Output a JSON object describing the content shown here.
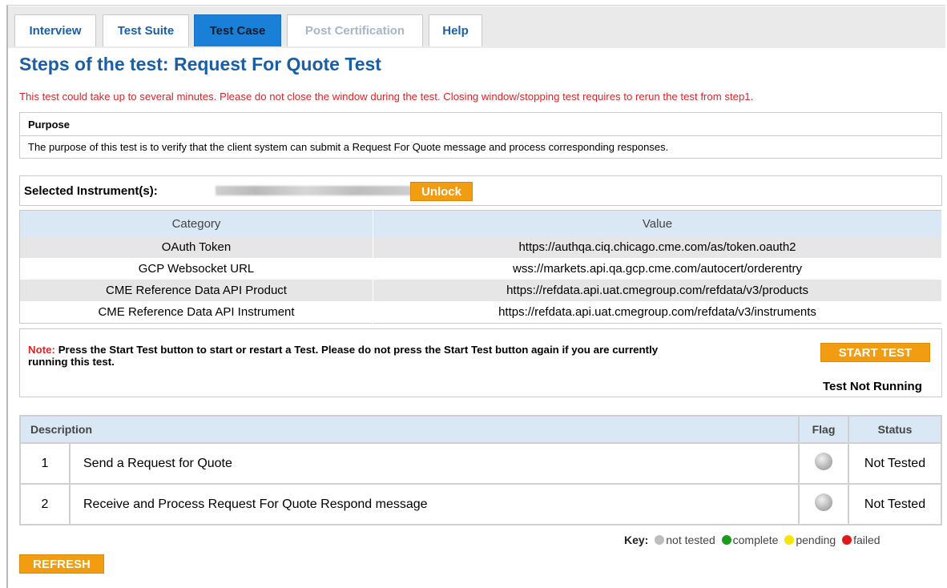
{
  "tabs": [
    {
      "label": "Interview",
      "state": "normal"
    },
    {
      "label": "Test Suite",
      "state": "normal"
    },
    {
      "label": "Test Case",
      "state": "active"
    },
    {
      "label": "Post Certification",
      "state": "disabled"
    },
    {
      "label": "Help",
      "state": "normal"
    }
  ],
  "page_title": "Steps of the test: Request For Quote Test",
  "warning": "This test could take up to several minutes. Please do not close the window during the test. Closing window/stopping test requires to rerun the test from step1.",
  "purpose": {
    "title": "Purpose",
    "text": "The purpose of this test is to verify that the client system can submit a Request For Quote message and process corresponding responses."
  },
  "instruments": {
    "label": "Selected Instrument(s):",
    "unlock_label": "Unlock"
  },
  "params": {
    "headers": [
      "Category",
      "Value"
    ],
    "rows": [
      [
        "OAuth Token",
        "https://authqa.ciq.chicago.cme.com/as/token.oauth2"
      ],
      [
        "GCP Websocket URL",
        "wss://markets.api.qa.gcp.cme.com/autocert/orderentry"
      ],
      [
        "CME Reference Data API Product",
        "https://refdata.api.uat.cmegroup.com/refdata/v3/products"
      ],
      [
        "CME Reference Data API Instrument",
        "https://refdata.api.uat.cmegroup.com/refdata/v3/instruments"
      ]
    ]
  },
  "note": {
    "label": "Note:",
    "text": "Press the Start Test button to start or restart a Test. Please do not press the Start Test button again if you are currently running this test."
  },
  "start_label": "START TEST",
  "test_status": "Test Not Running",
  "steps": {
    "headers": [
      "Description",
      "Flag",
      "Status"
    ],
    "rows": [
      {
        "num": "1",
        "desc": "Send a Request for Quote",
        "status": "Not Tested"
      },
      {
        "num": "2",
        "desc": "Receive and Process Request For Quote Respond message",
        "status": "Not Tested"
      }
    ]
  },
  "key": {
    "label": "Key:",
    "items": [
      {
        "label": "not tested",
        "color": "#bdbdbd"
      },
      {
        "label": "complete",
        "color": "#1a9e1a"
      },
      {
        "label": "pending",
        "color": "#f5e500"
      },
      {
        "label": "failed",
        "color": "#e0191b"
      }
    ]
  },
  "refresh_label": "REFRESH"
}
